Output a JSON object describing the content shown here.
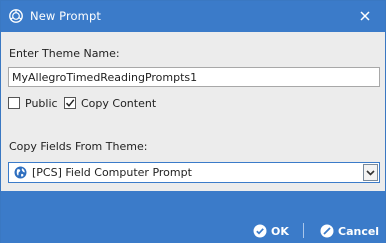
{
  "window": {
    "title": "New Prompt",
    "title_icon": "prompt-app-icon",
    "close_icon": "close-icon"
  },
  "form": {
    "theme_name_label": "Enter Theme Name:",
    "theme_name_value": "MyAllegroTimedReadingPrompts1",
    "public_label": "Public",
    "public_checked": false,
    "copy_content_label": "Copy Content",
    "copy_content_checked": true,
    "copy_fields_label": "Copy Fields From Theme:",
    "copy_fields_selected": "[PCS] Field Computer Prompt",
    "copy_fields_icon": "globe-icon"
  },
  "footer": {
    "ok_label": "OK",
    "ok_icon": "check-circle-icon",
    "cancel_label": "Cancel",
    "cancel_icon": "cancel-circle-icon"
  },
  "colors": {
    "accent": "#3b7bc9",
    "body_bg": "#ececec"
  }
}
